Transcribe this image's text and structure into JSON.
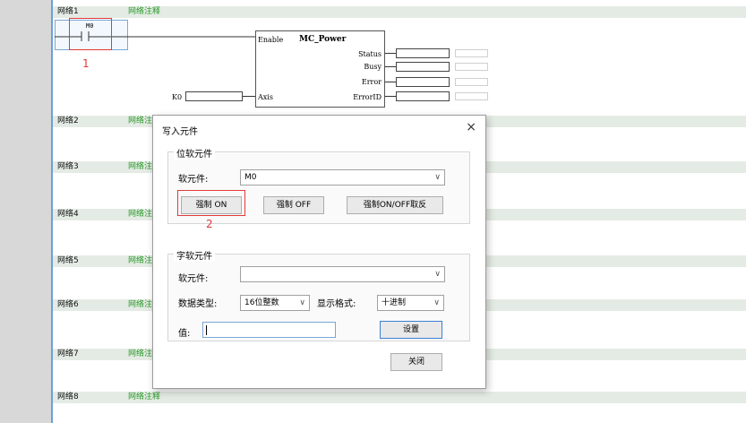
{
  "networks": [
    {
      "label": "网络1",
      "comment": "网络注释"
    },
    {
      "label": "网络2",
      "comment": "网络注"
    },
    {
      "label": "网络3",
      "comment": "网络注"
    },
    {
      "label": "网络4",
      "comment": "网络注"
    },
    {
      "label": "网络5",
      "comment": "网络注"
    },
    {
      "label": "网络6",
      "comment": "网络注"
    },
    {
      "label": "网络7",
      "comment": "网络注"
    },
    {
      "label": "网络8",
      "comment": "网络注释"
    }
  ],
  "ladder": {
    "contact_name": "M0",
    "fb_enable": "Enable",
    "fb_name": "MC_Power",
    "fb_axis": "Axis",
    "outputs": [
      "Status",
      "Busy",
      "Error",
      "ErrorID"
    ],
    "axis_input_label": "K0"
  },
  "annotations": {
    "one": "1",
    "two": "2"
  },
  "dialog": {
    "title": "写入元件",
    "close": "×",
    "bit_group": {
      "title": "位软元件",
      "device_label": "软元件:",
      "device_value": "M0",
      "force_on": "强制 ON",
      "force_off": "强制 OFF",
      "force_toggle": "强制ON/OFF取反"
    },
    "word_group": {
      "title": "字软元件",
      "device_label": "软元件:",
      "device_value": "",
      "data_type_label": "数据类型:",
      "data_type_value": "16位整数",
      "display_format_label": "显示格式:",
      "display_format_value": "十进制",
      "value_label": "值:",
      "value": "",
      "set_button": "设置"
    },
    "close_button": "关闭"
  },
  "colors": {
    "accent_blue": "#3c7fd6",
    "highlight_red": "#e23a3a",
    "comment_green": "#2a9a2a"
  }
}
